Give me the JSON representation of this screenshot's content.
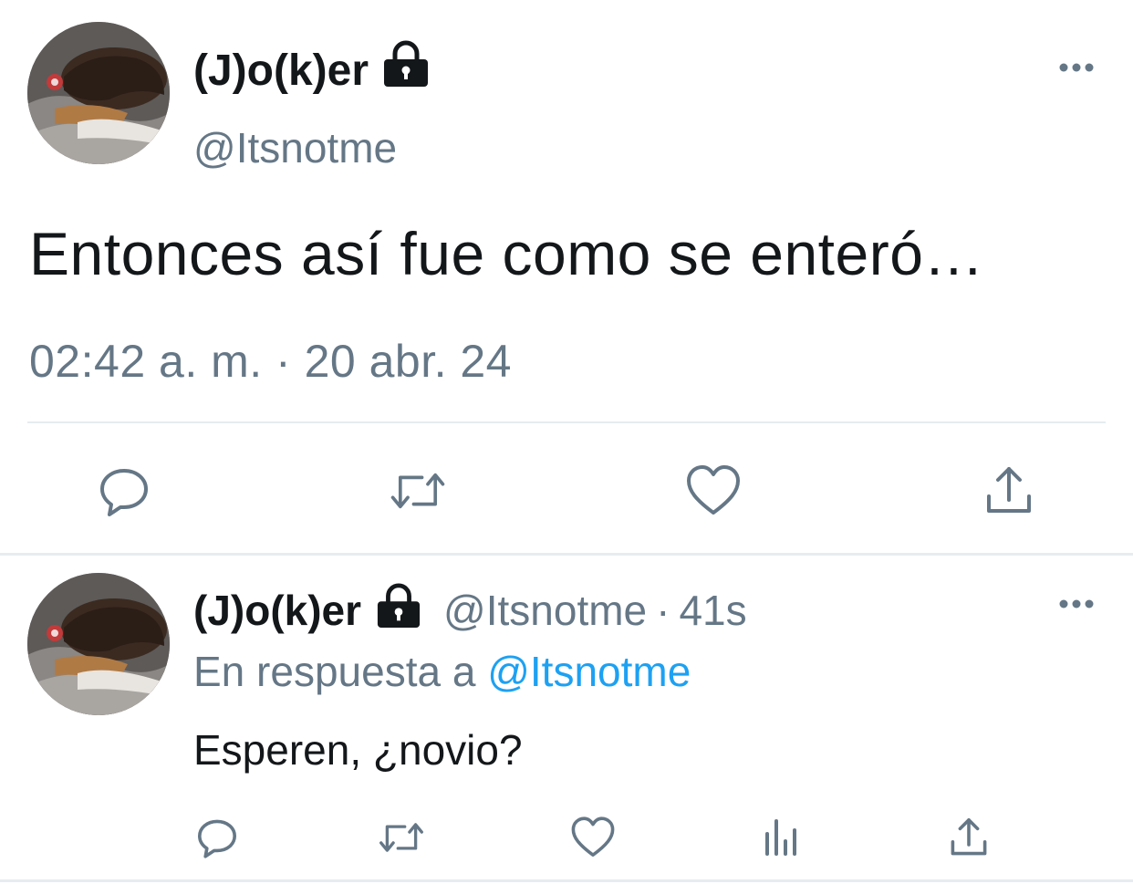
{
  "main_tweet": {
    "display_name": "(J)o(k)er",
    "handle": "@Itsnotme",
    "text": "Entonces así fue como se enteró…",
    "timestamp": "02:42 a. m. · 20 abr. 24",
    "actions": [
      "reply-icon",
      "retweet-icon",
      "like-icon",
      "share-icon"
    ]
  },
  "reply_tweet": {
    "display_name": "(J)o(k)er",
    "handle": "@Itsnotme",
    "separator": "·",
    "time": "41s",
    "reply_to_prefix": "En respuesta a",
    "reply_to_handle": "@Itsnotme",
    "text": "Esperen, ¿novio?",
    "actions": [
      "reply-icon",
      "retweet-icon",
      "like-icon",
      "analytics-icon",
      "share-icon"
    ]
  },
  "colors": {
    "text_primary": "#14171a",
    "text_secondary": "#657786",
    "link": "#1da1f2",
    "divider": "#e6ecf0"
  }
}
